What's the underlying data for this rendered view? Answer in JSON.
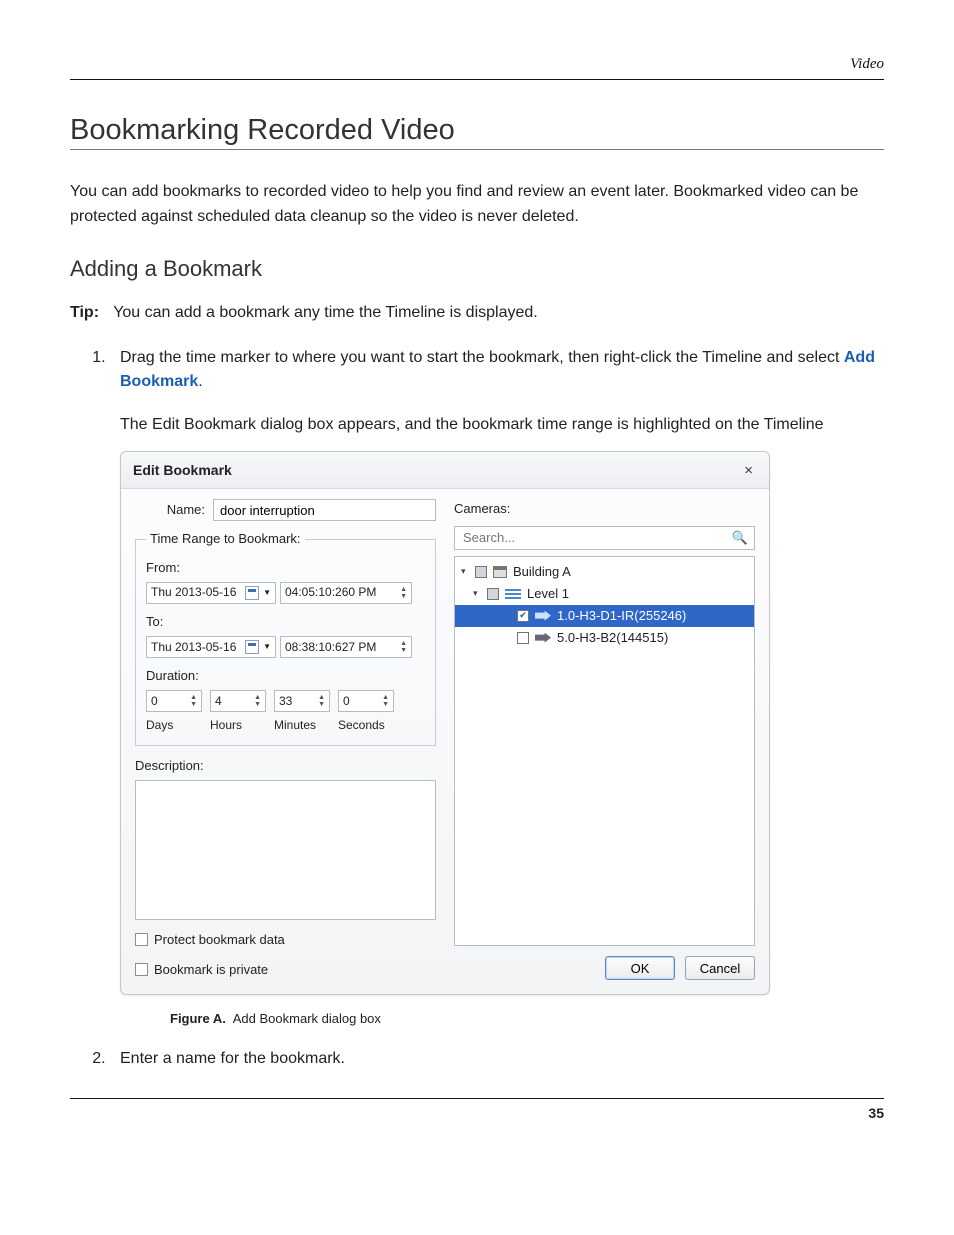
{
  "header": {
    "crumb": "Video"
  },
  "section": {
    "title": "Bookmarking Recorded Video",
    "intro": "You can add bookmarks to recorded video to help you find and review an event later. Bookmarked video can be protected against scheduled data cleanup so the video is never deleted.",
    "subheading": "Adding a Bookmark",
    "tip_label": "Tip:",
    "tip_text": "You can add a bookmark any time the Timeline is displayed.",
    "step1_a": "Drag the time marker to where you want to start the bookmark, then right-click the Timeline and select ",
    "step1_cmd": "Add Bookmark",
    "step1_b": ".",
    "step1_follow": "The Edit Bookmark dialog box appears, and the bookmark time range is highlighted on the Timeline",
    "figure_label": "Figure A.",
    "figure_caption": "Add Bookmark dialog box",
    "step2": "Enter a name for the bookmark."
  },
  "dialog": {
    "title": "Edit Bookmark",
    "name_label": "Name:",
    "name_value": "door interruption",
    "time_range_legend": "Time Range to Bookmark:",
    "from_label": "From:",
    "from_date": "Thu 2013-05-16",
    "from_time": "04:05:10:260  PM",
    "to_label": "To:",
    "to_date": "Thu 2013-05-16",
    "to_time": "08:38:10:627  PM",
    "duration_label": "Duration:",
    "duration": {
      "days": "0",
      "hours": "4",
      "minutes": "33",
      "seconds": "0"
    },
    "units": {
      "days": "Days",
      "hours": "Hours",
      "minutes": "Minutes",
      "seconds": "Seconds"
    },
    "description_label": "Description:",
    "protect_label": "Protect bookmark data",
    "private_label": "Bookmark is private",
    "cameras_label": "Cameras:",
    "search_placeholder": "Search...",
    "tree": {
      "site": "Building A",
      "level": "Level 1",
      "cam1": "1.0-H3-D1-IR(255246)",
      "cam2": "5.0-H3-B2(144515)"
    },
    "ok": "OK",
    "cancel": "Cancel"
  },
  "footer": {
    "page": "35"
  }
}
